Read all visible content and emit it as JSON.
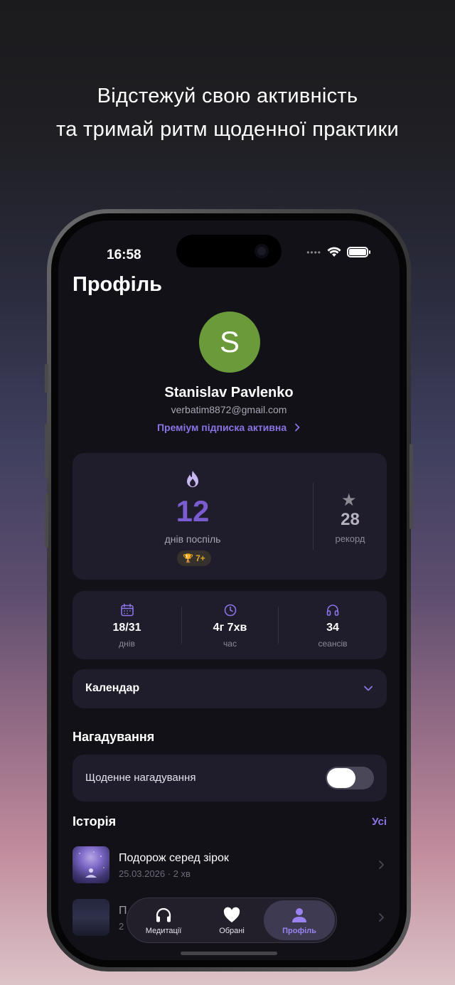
{
  "promo": {
    "line1": "Відстежуй свою активність",
    "line2": "та тримай ритм щоденної практики"
  },
  "status_bar": {
    "time": "16:58",
    "icons": [
      "wifi-icon",
      "battery-icon"
    ]
  },
  "page_title": "Профіль",
  "profile": {
    "avatar_letter": "S",
    "avatar_color": "#6a9a3a",
    "name": "Stanislav Pavlenko",
    "email": "verbatim8872@gmail.com",
    "premium_link": "Преміум підписка активна"
  },
  "streak": {
    "value": "12",
    "label": "днів поспіль",
    "badge": "7+",
    "record_value": "28",
    "record_label": "рекорд"
  },
  "stats": [
    {
      "icon": "calendar-icon",
      "value": "18/31",
      "label": "днів"
    },
    {
      "icon": "clock-icon",
      "value": "4г 7хв",
      "label": "час"
    },
    {
      "icon": "headphones-icon",
      "value": "34",
      "label": "сеансів"
    }
  ],
  "calendar": {
    "label": "Календар"
  },
  "reminders": {
    "heading": "Нагадування",
    "daily_label": "Щоденне нагадування",
    "daily_enabled": false
  },
  "history": {
    "heading": "Історія",
    "all_link": "Усі",
    "items": [
      {
        "title": "Подорож серед зірок",
        "subtitle": "25.03.2026 · 2 хв"
      },
      {
        "title": "П",
        "subtitle": "2"
      }
    ]
  },
  "tabbar": {
    "items": [
      {
        "label": "Медитації",
        "icon": "headphones-icon"
      },
      {
        "label": "Обрані",
        "icon": "heart-icon"
      },
      {
        "label": "Профіль",
        "icon": "person-icon"
      }
    ],
    "active": "Профіль"
  },
  "colors": {
    "accent": "#8b73e6",
    "background": "#131118",
    "card": "#1f1c2b",
    "streak_badge": "#e0a52a"
  }
}
